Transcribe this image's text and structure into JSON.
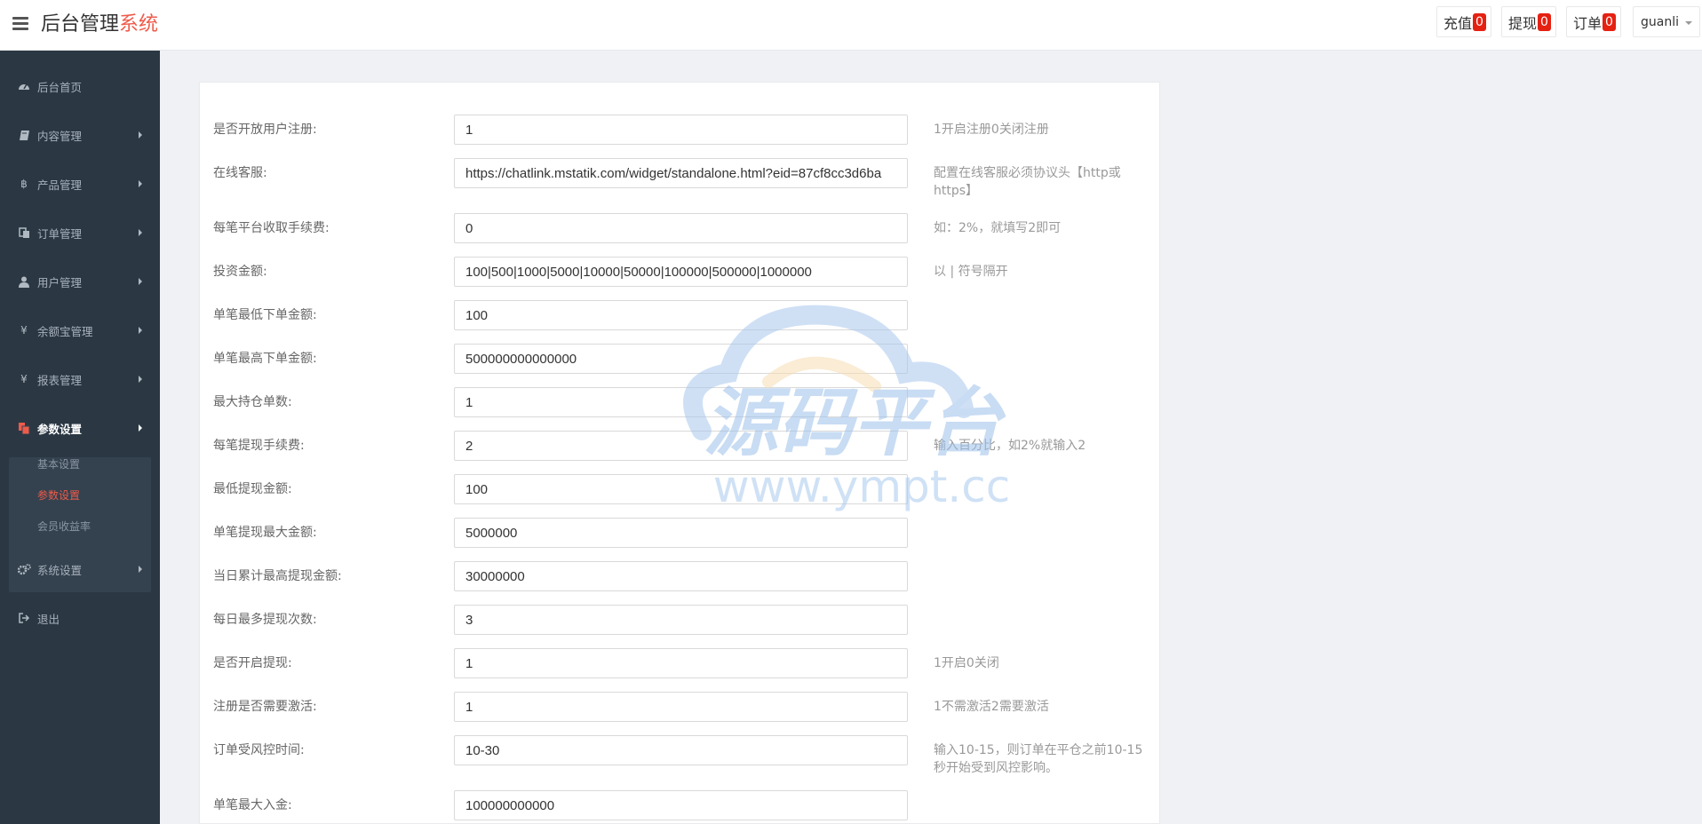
{
  "brand": {
    "title_main": "后台管理",
    "title_accent": "系统"
  },
  "topbar": {
    "buttons": [
      {
        "label": "充值",
        "count": "0"
      },
      {
        "label": "提现",
        "count": "0"
      },
      {
        "label": "订单",
        "count": "0"
      }
    ],
    "user": "guanli"
  },
  "sidebar": {
    "items": [
      {
        "label": "后台首页",
        "icon": "dashboard-icon"
      },
      {
        "label": "内容管理",
        "icon": "book-icon"
      },
      {
        "label": "产品管理",
        "icon": "bitcoin-icon"
      },
      {
        "label": "订单管理",
        "icon": "copy-icon"
      },
      {
        "label": "用户管理",
        "icon": "user-icon"
      },
      {
        "label": "余额宝管理",
        "icon": "yen-icon"
      },
      {
        "label": "报表管理",
        "icon": "yen-icon"
      },
      {
        "label": "参数设置",
        "icon": "files-icon"
      },
      {
        "label": "系统设置",
        "icon": "cogs-icon"
      },
      {
        "label": "退出",
        "icon": "sign-out-icon"
      }
    ],
    "sub_items": [
      {
        "label": "基本设置"
      },
      {
        "label": "参数设置"
      },
      {
        "label": "会员收益率"
      }
    ]
  },
  "form": {
    "rows": [
      {
        "label": "是否开放用户注册:",
        "value": "1",
        "hint": "1开启注册0关闭注册"
      },
      {
        "label": "在线客服:",
        "value": "https://chatlink.mstatik.com/widget/standalone.html?eid=87cf8cc3d6ba",
        "hint": "配置在线客服必须协议头【http或https】"
      },
      {
        "label": "每笔平台收取手续费:",
        "value": "0",
        "hint": "如：2%，就填写2即可"
      },
      {
        "label": "投资金额:",
        "value": "100|500|1000|5000|10000|50000|100000|500000|1000000",
        "hint": "以 | 符号隔开"
      },
      {
        "label": "单笔最低下单金额:",
        "value": "100",
        "hint": ""
      },
      {
        "label": "单笔最高下单金额:",
        "value": "500000000000000",
        "hint": ""
      },
      {
        "label": "最大持仓单数:",
        "value": "1",
        "hint": ""
      },
      {
        "label": "每笔提现手续费:",
        "value": "2",
        "hint": "输入百分比，如2%就输入2"
      },
      {
        "label": "最低提现金额:",
        "value": "100",
        "hint": ""
      },
      {
        "label": "单笔提现最大金额:",
        "value": "5000000",
        "hint": ""
      },
      {
        "label": "当日累计最高提现金额:",
        "value": "30000000",
        "hint": ""
      },
      {
        "label": "每日最多提现次数:",
        "value": "3",
        "hint": ""
      },
      {
        "label": "是否开启提现:",
        "value": "1",
        "hint": "1开启0关闭"
      },
      {
        "label": "注册是否需要激活:",
        "value": "1",
        "hint": "1不需激活2需要激活"
      },
      {
        "label": "订单受风控时间:",
        "value": "10-30",
        "hint": "输入10-15，则订单在平仓之前10-15秒开始受到风控影响。"
      },
      {
        "label": "单笔最大入金:",
        "value": "100000000000",
        "hint": ""
      }
    ]
  },
  "watermark": {
    "title": "源码平台",
    "url": "www.ympt.cc"
  }
}
